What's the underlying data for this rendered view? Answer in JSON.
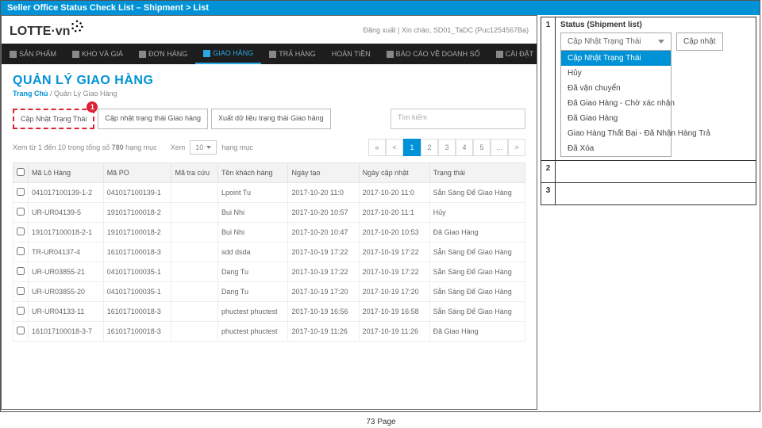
{
  "slide": {
    "title": "Seller Office Status Check List – Shipment > List",
    "footer": "73  Page"
  },
  "left": {
    "logo_text": "LOTTE·",
    "logo_suffix": "vn",
    "top_right": "Đăng xuất  |  Xin chào, SD01_TaDC (Puc1254567Ba)",
    "nav": [
      {
        "icon": "cube",
        "label": "SẢN PHẨM"
      },
      {
        "icon": "box",
        "label": "KHO VÀ GIÁ"
      },
      {
        "icon": "cart",
        "label": "ĐƠN HÀNG"
      },
      {
        "icon": "truck",
        "label": "GIAO HÀNG",
        "active": true
      },
      {
        "icon": "return",
        "label": "TRẢ HÀNG"
      },
      {
        "icon": "",
        "label": "HOÀN TIỀN"
      },
      {
        "icon": "chart",
        "label": "BÁO CÁO VỀ DOANH SỐ"
      },
      {
        "icon": "gear",
        "label": "CÀI ĐẶT"
      }
    ],
    "heading": "QUẢN LÝ GIAO HÀNG",
    "breadcrumb_home": "Trang Chủ",
    "breadcrumb_sep": " / ",
    "breadcrumb_here": "Quản Lý Giao Hàng",
    "buttons": {
      "b1": "Cập Nhật Trạng Thái",
      "b2": "Cập nhật trạng thái Giao hàng",
      "b3": "Xuất dữ liệu trạng thái Giao hàng"
    },
    "badge": "1",
    "search_ph": "Tìm kiếm",
    "pager_text_a": "Xem từ 1 đến 10 trong tổng số ",
    "pager_total": "780",
    "pager_text_b": " hạng mục",
    "pager_show": "Xem",
    "pager_page": "10",
    "pager_unit": "hạng mục",
    "pager_nums": [
      "«",
      "<",
      "1",
      "2",
      "3",
      "4",
      "5",
      "...",
      ">"
    ],
    "pager_cur": "1",
    "headers": {
      "lo": "Mã Lô Hàng",
      "po": "Mã PO",
      "tra": "Mã tra cứu",
      "kh": "Tên khách hàng",
      "tao": "Ngày tạo",
      "cap": "Ngày cập nhật",
      "tt": "Trạng thái"
    },
    "rows": [
      {
        "lo": "041017100139-1-2",
        "po": "041017100139-1",
        "tra": "",
        "kh": "Lpoint Tu",
        "tao": "2017-10-20 11:0",
        "cap": "2017-10-20 11:0",
        "tt": "Sẵn Sàng Để Giao Hàng"
      },
      {
        "lo": "UR-UR04139-5",
        "po": "191017100018-2",
        "tra": "",
        "kh": "Bui Nhi",
        "tao": "2017-10-20 10:57",
        "cap": "2017-10-20 11:1",
        "tt": "Hủy"
      },
      {
        "lo": "191017100018-2-1",
        "po": "191017100018-2",
        "tra": "",
        "kh": "Bui Nhi",
        "tao": "2017-10-20 10:47",
        "cap": "2017-10-20 10:53",
        "tt": "Đã Giao Hàng"
      },
      {
        "lo": "TR-UR04137-4",
        "po": "161017100018-3",
        "tra": "",
        "kh": "sdd dsda",
        "tao": "2017-10-19 17:22",
        "cap": "2017-10-19 17:22",
        "tt": "Sẵn Sàng Để Giao Hàng"
      },
      {
        "lo": "UR-UR03855-21",
        "po": "041017100035-1",
        "tra": "",
        "kh": "Dang Tu",
        "tao": "2017-10-19 17:22",
        "cap": "2017-10-19 17:22",
        "tt": "Sẵn Sàng Để Giao Hàng"
      },
      {
        "lo": "UR-UR03855-20",
        "po": "041017100035-1",
        "tra": "",
        "kh": "Dang Tu",
        "tao": "2017-10-19 17:20",
        "cap": "2017-10-19 17:20",
        "tt": "Sẵn Sàng Để Giao Hàng"
      },
      {
        "lo": "UR-UR04133-11",
        "po": "161017100018-3",
        "tra": "",
        "kh": "phuctest phuctest",
        "tao": "2017-10-19 16:56",
        "cap": "2017-10-19 16:58",
        "tt": "Sẵn Sàng Để Giao Hàng"
      },
      {
        "lo": "161017100018-3-7",
        "po": "161017100018-3",
        "tra": "",
        "kh": "phuctest phuctest",
        "tao": "2017-10-19 11:26",
        "cap": "2017-10-19 11:26",
        "tt": "Đã Giao Hàng"
      }
    ]
  },
  "right": {
    "row1_title": "Status (Shipment list)",
    "dd_value": "Cập Nhật Trạng Thái",
    "dd_items": [
      "Cập Nhật Trạng Thái",
      "Hủy",
      "Đã vận chuyển",
      "Đã Giao Hàng - Chờ xác nhận",
      "Đã Giao Hàng",
      "Giao Hàng Thất Bại - Đã Nhận Hàng Trả",
      "Đã Xóa"
    ],
    "dd_button": "Cập nhật",
    "n1": "1",
    "n2": "2",
    "n3": "3"
  }
}
